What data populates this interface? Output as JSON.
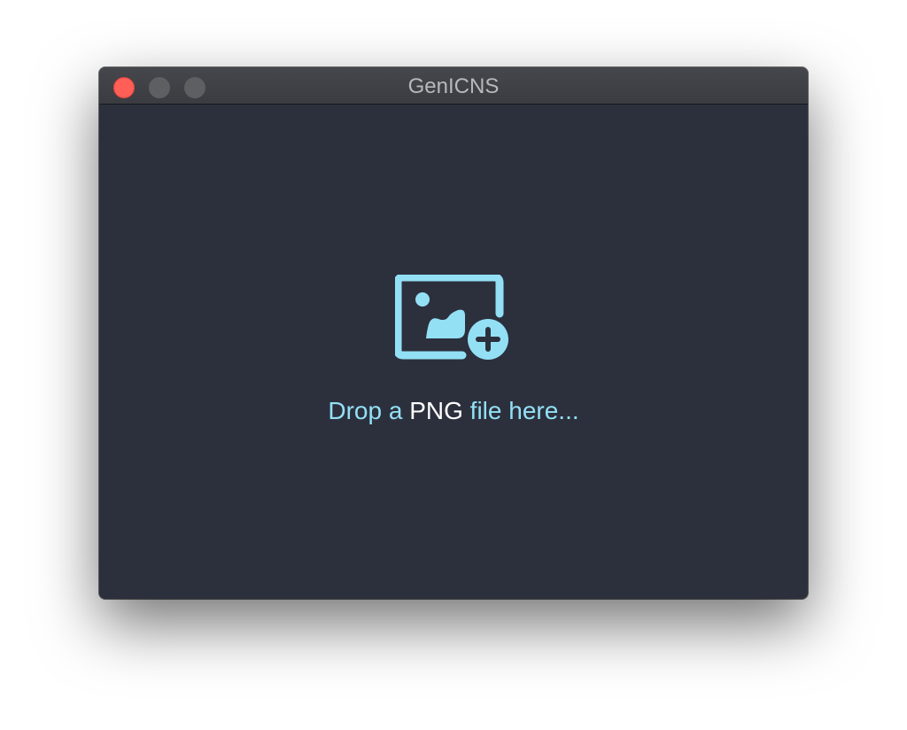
{
  "window": {
    "title": "GenICNS"
  },
  "drop_zone": {
    "icon": "image-add-icon",
    "text_before": "Drop a ",
    "text_highlight": "PNG",
    "text_after": " file here..."
  },
  "colors": {
    "background": "#2c303d",
    "accent": "#93e0f5",
    "highlight": "#ffffff",
    "close_button": "#ff5f57"
  }
}
